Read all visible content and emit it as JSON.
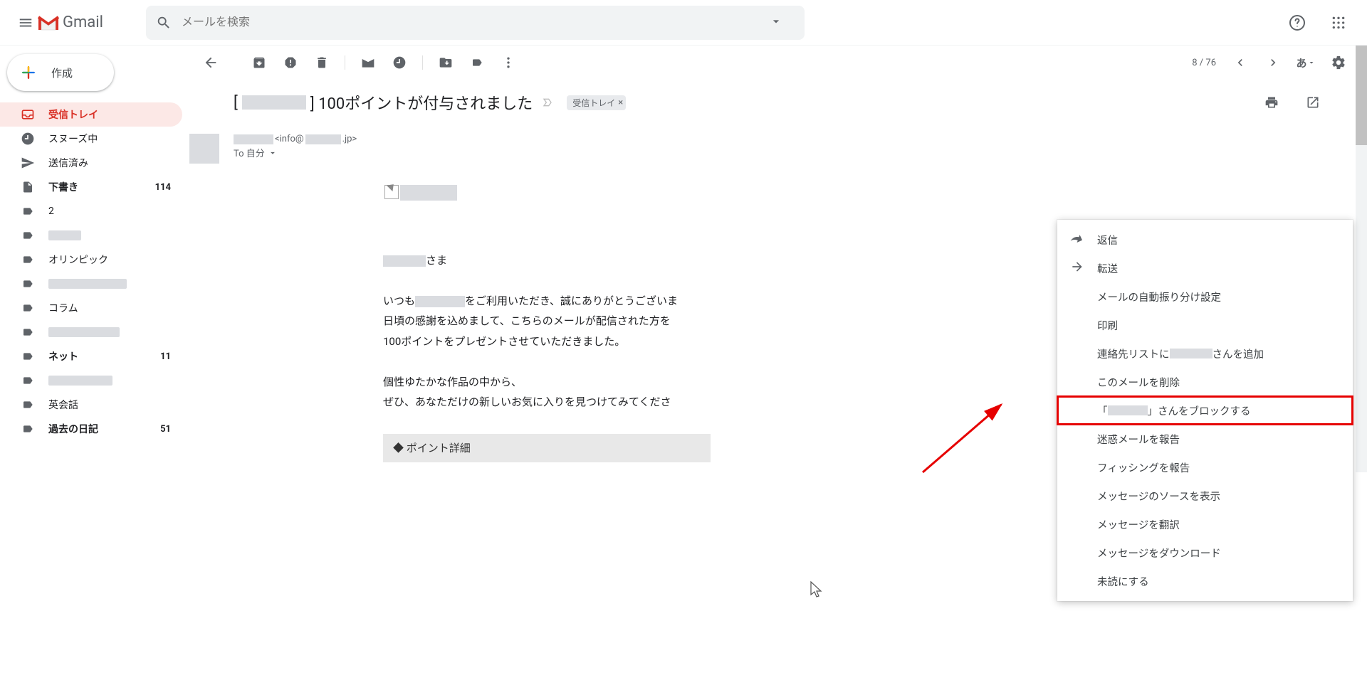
{
  "header": {
    "app_name": "Gmail",
    "search_placeholder": "メールを検索"
  },
  "compose": {
    "label": "作成"
  },
  "sidebar": {
    "items": [
      {
        "label": "受信トレイ",
        "count": ""
      },
      {
        "label": "スヌーズ中",
        "count": ""
      },
      {
        "label": "送信済み",
        "count": ""
      },
      {
        "label": "下書き",
        "count": "114"
      },
      {
        "label": "2",
        "count": ""
      },
      {
        "label": "",
        "count": ""
      },
      {
        "label": "オリンピック",
        "count": ""
      },
      {
        "label": "",
        "count": ""
      },
      {
        "label": "コラム",
        "count": ""
      },
      {
        "label": "",
        "count": ""
      },
      {
        "label": "ネット",
        "count": "11"
      },
      {
        "label": "",
        "count": ""
      },
      {
        "label": "英会話",
        "count": ""
      },
      {
        "label": "過去の日記",
        "count": "51"
      }
    ]
  },
  "toolbar": {
    "page_info": "8 / 76",
    "lang": "あ"
  },
  "message": {
    "subject_prefix": "[",
    "subject_suffix": "] 100ポイントが付与されました",
    "inbox_chip": "受信トレイ",
    "sender_addr_pre": "<info@",
    "sender_addr_post": ".jp>",
    "to_self": "To 自分",
    "body": {
      "greet_suffix": "さま",
      "line1_pre": "いつも",
      "line1_post": "をご利用いただき、誠にありがとうございま",
      "line2": "日頃の感謝を込めまして、こちらのメールが配信された方を",
      "line3": "100ポイントをプレゼントさせていただきました。",
      "line4": "個性ゆたかな作品の中から、",
      "line5": "ぜひ、あなただけの新しいお気に入りを見つけてみてくださ",
      "point_detail": "◆ ポイント詳細"
    }
  },
  "ctxmenu": {
    "reply": "返信",
    "forward": "転送",
    "filter": "メールの自動振り分け設定",
    "print": "印刷",
    "add_contact_pre": "連絡先リストに",
    "add_contact_post": "さんを追加",
    "delete": "このメールを削除",
    "block_pre": "「",
    "block_post": "」さんをブロックする",
    "spam": "迷惑メールを報告",
    "phishing": "フィッシングを報告",
    "source": "メッセージのソースを表示",
    "translate": "メッセージを翻訳",
    "download": "メッセージをダウンロード",
    "unread": "未読にする"
  }
}
